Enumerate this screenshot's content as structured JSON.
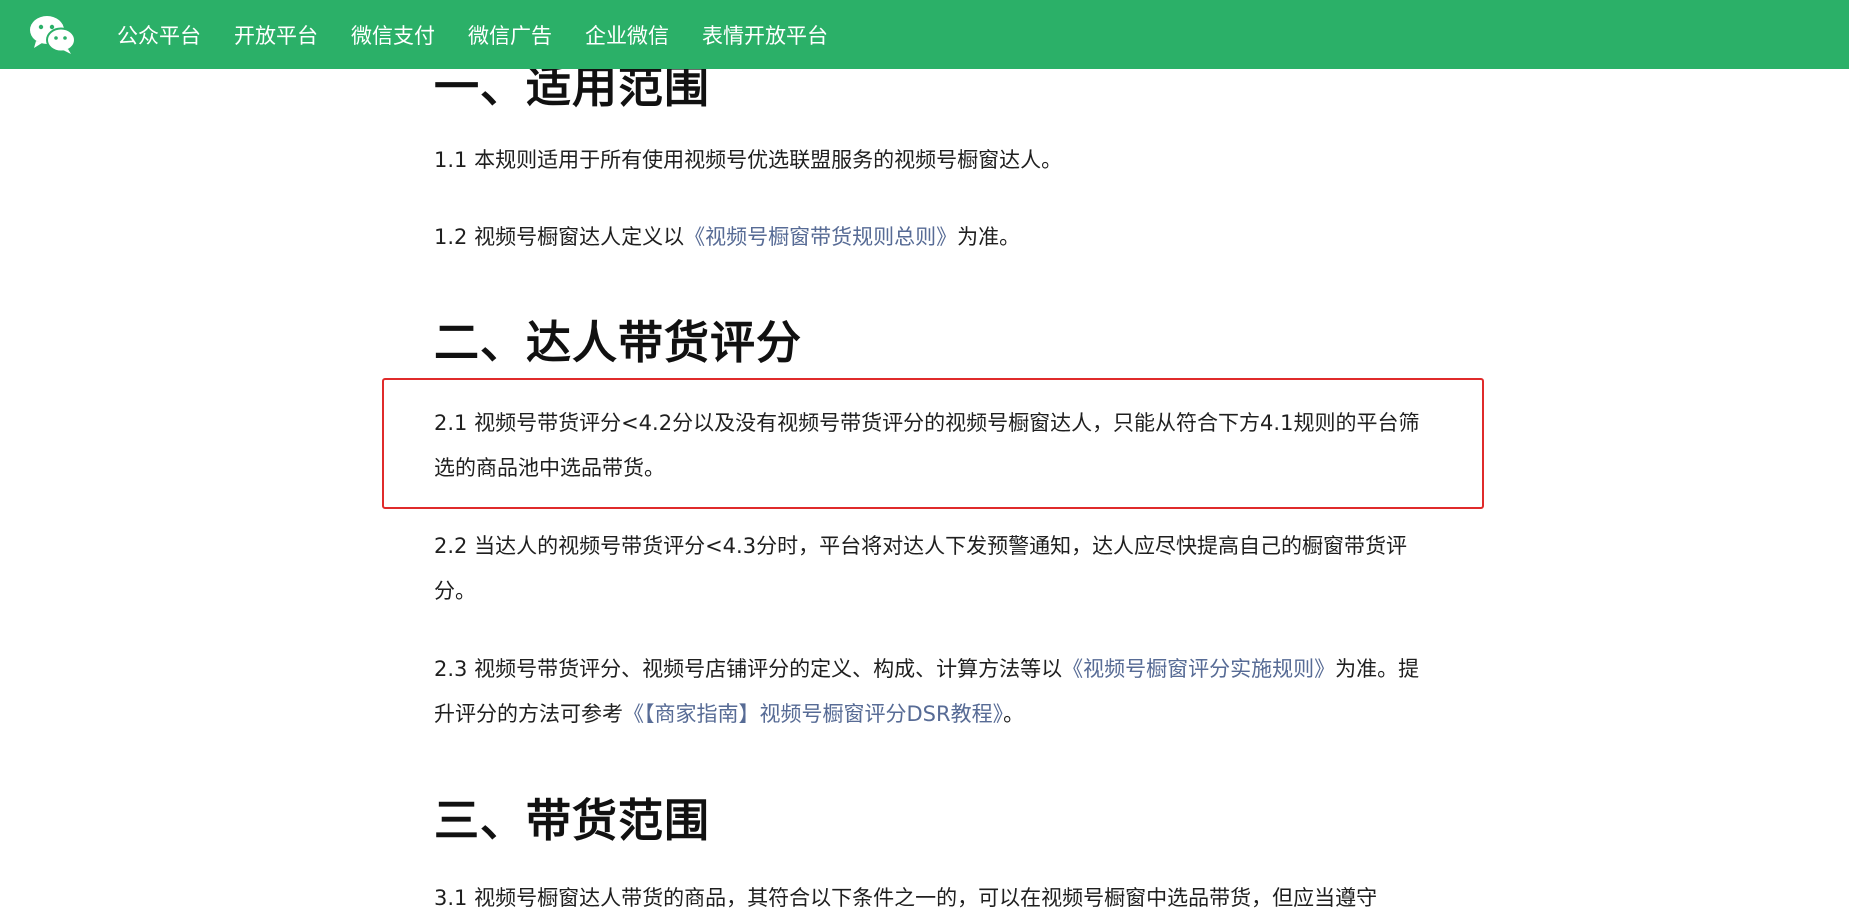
{
  "topbar": {
    "logo_icon": "wechat-logo-icon",
    "nav": [
      "公众平台",
      "开放平台",
      "微信支付",
      "微信广告",
      "企业微信",
      "表情开放平台"
    ]
  },
  "sections": {
    "s1": {
      "title": "一、适用范围",
      "p1": "1.1 本规则适用于所有使用视频号优选联盟服务的视频号橱窗达人。",
      "p2_prefix": "1.2 视频号橱窗达人定义以",
      "p2_link": "《视频号橱窗带货规则总则》",
      "p2_suffix": "为准。"
    },
    "s2": {
      "title": "二、达人带货评分",
      "p1_line1": "2.1 视频号带货评分<4.2分以及没有视频号带货评分的视频号橱窗达人，只能从符合下方4.1规则的平台筛",
      "p1_line2": "选的商品池中选品带货。",
      "p2_line1": "2.2 当达人的视频号带货评分<4.3分时，平台将对达人下发预警通知，达人应尽快提高自己的橱窗带货评",
      "p2_line2": "分。",
      "p3_prefix": "2.3 视频号带货评分、视频号店铺评分的定义、构成、计算方法等以",
      "p3_link1": "《视频号橱窗评分实施规则》",
      "p3_mid": "为准。提",
      "p3_line2_prefix": "升评分的方法可参考",
      "p3_link2": "《【商家指南】视频号橱窗评分DSR教程》",
      "p3_suffix": "。"
    },
    "s3": {
      "title": "三、带货范围",
      "p1_partial": "3.1 视频号橱窗达人带货的商品，其符合以下条件之一的，可以在视频号橱窗中选品带货，但应当遵守"
    }
  },
  "colors": {
    "topbar_bg": "#2bb068",
    "link": "#576b95",
    "highlight_border": "#e02b2b"
  }
}
